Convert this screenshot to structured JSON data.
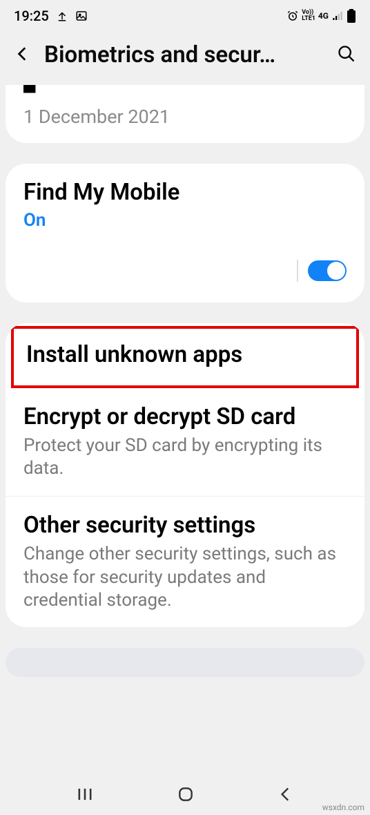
{
  "status": {
    "time": "19:25"
  },
  "header": {
    "title": "Biometrics and secur…"
  },
  "partial": {
    "date": "1 December 2021"
  },
  "find": {
    "title": "Find My Mobile",
    "status": "On"
  },
  "settings": {
    "install": {
      "title": "Install unknown apps"
    },
    "encrypt": {
      "title": "Encrypt or decrypt SD card",
      "desc": "Protect your SD card by encrypting its data."
    },
    "other": {
      "title": "Other security settings",
      "desc": "Change other security settings, such as those for security updates and credential storage."
    }
  },
  "watermark": "wsxdn.com"
}
